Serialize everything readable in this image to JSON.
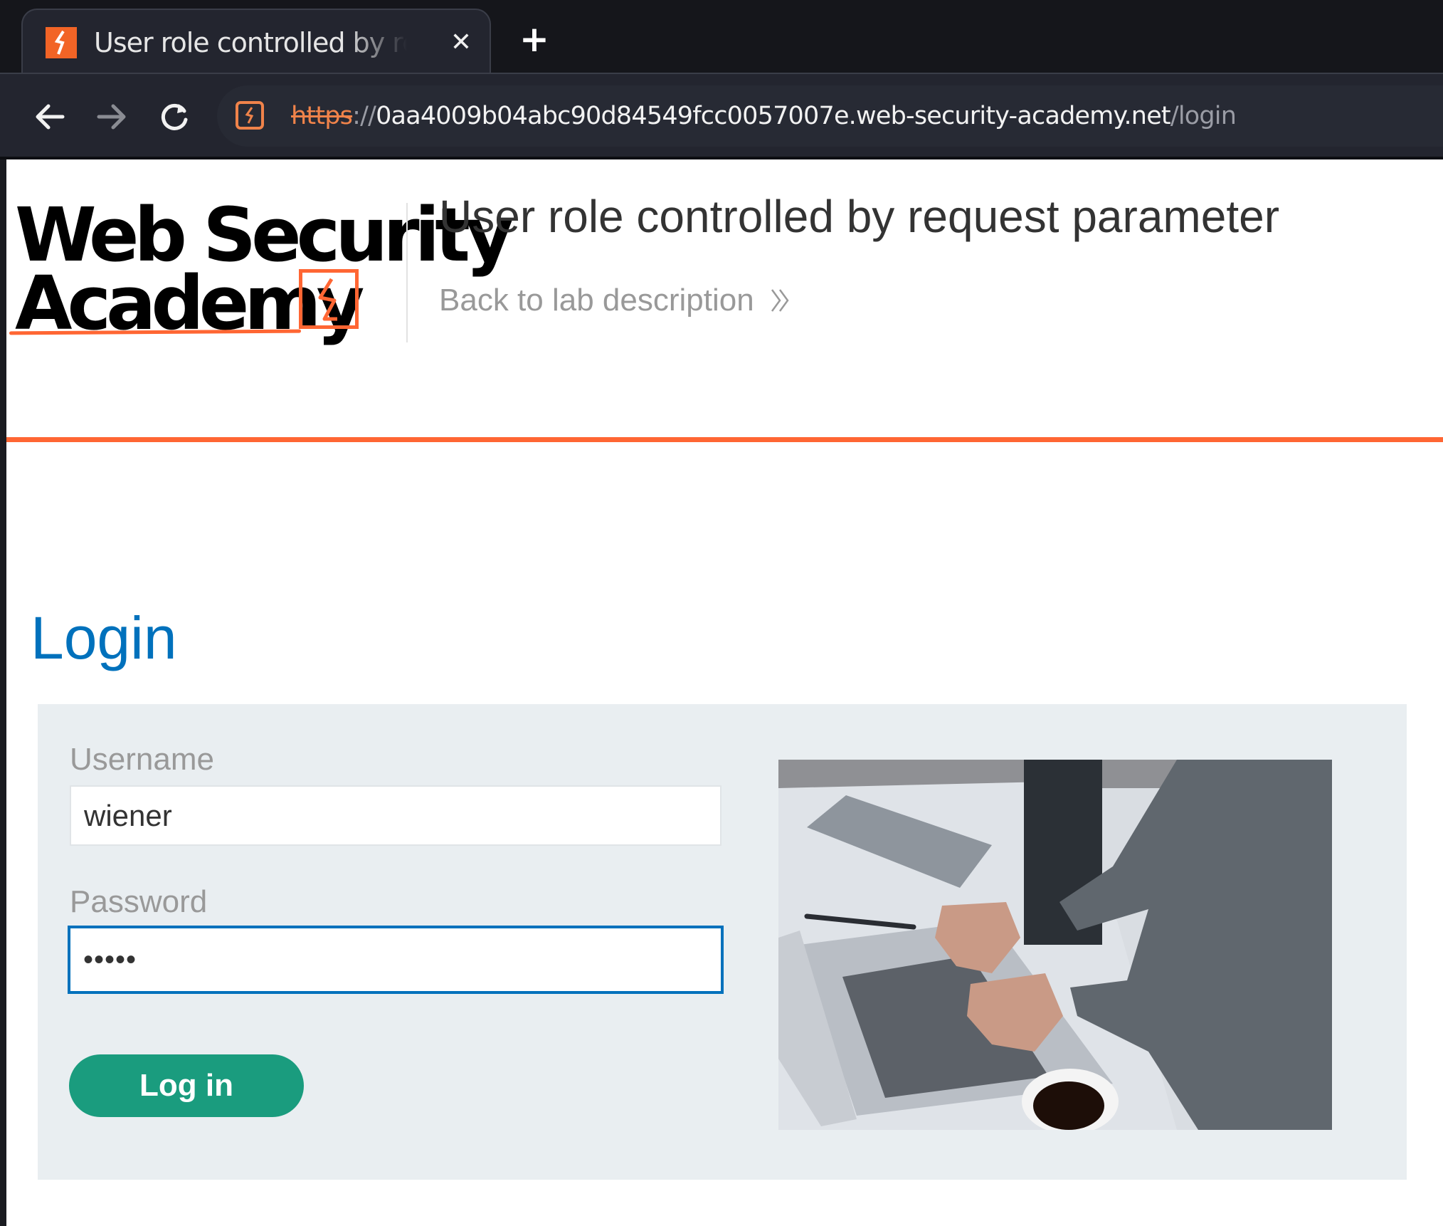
{
  "browser": {
    "tab": {
      "title": "User role controlled by request parameter",
      "favicon": "web-security-academy-icon",
      "close_icon": "close-icon"
    },
    "new_tab_icon": "plus-icon",
    "nav": {
      "back_icon": "arrow-left-icon",
      "forward_icon": "arrow-right-icon",
      "reload_icon": "reload-icon"
    },
    "address_bar": {
      "site_icon": "not-secure-site-icon",
      "scheme": "https",
      "separator": "://",
      "host": "0aa4009b04abc90d84549fcc0057007e.web-security-academy.net",
      "path": "/login"
    }
  },
  "header": {
    "logo_line1": "Web Security",
    "logo_line2": "Academy",
    "lab_title": "User role controlled by request parameter",
    "back_link": "Back to lab description",
    "back_icon": "double-chevron-right-icon"
  },
  "colors": {
    "brand_orange": "#ff6633",
    "heading_blue": "#0071bc",
    "button_green": "#1a9c7e",
    "panel_gray": "#e9eef1"
  },
  "login": {
    "heading": "Login",
    "username_label": "Username",
    "username_value": "wiener",
    "password_label": "Password",
    "password_value": "peter",
    "submit_label": "Log in",
    "image": "person-typing-on-laptop-photo"
  }
}
